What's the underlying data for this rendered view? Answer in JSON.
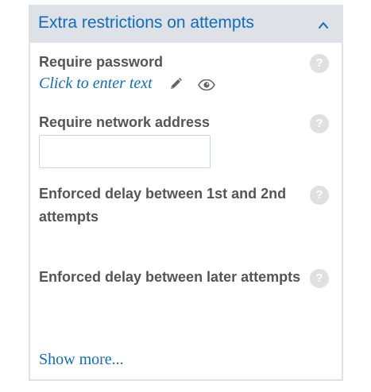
{
  "section": {
    "title": "Extra restrictions on attempts",
    "collapse_icon": "chevron-up-icon"
  },
  "fields": {
    "require_password": {
      "label": "Require password",
      "value_text": "Click to enter text",
      "edit_icon": "pencil-icon",
      "reveal_icon": "eye-icon",
      "help_icon": "?"
    },
    "require_network_address": {
      "label": "Require network address",
      "value": "",
      "help_icon": "?"
    },
    "delay_first_second": {
      "label": "Enforced delay between 1st and 2nd attempts",
      "help_icon": "?"
    },
    "delay_later": {
      "label": "Enforced delay between later attempts",
      "help_icon": "?"
    }
  },
  "show_more_label": "Show more...",
  "colors": {
    "link": "#0f6cbf",
    "header_bg": "#dee2e6",
    "label_text": "#555555",
    "help_bg": "#e0e0e0"
  }
}
